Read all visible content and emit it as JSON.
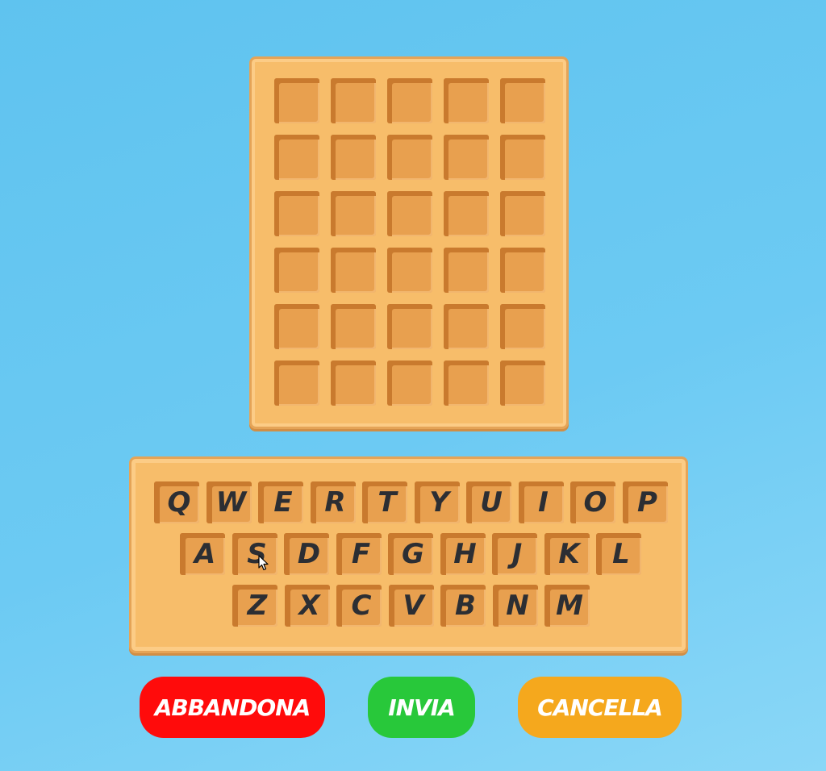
{
  "board": {
    "rows": 6,
    "cols": 5,
    "cells": [
      [
        "",
        "",
        "",
        "",
        ""
      ],
      [
        "",
        "",
        "",
        "",
        ""
      ],
      [
        "",
        "",
        "",
        "",
        ""
      ],
      [
        "",
        "",
        "",
        "",
        ""
      ],
      [
        "",
        "",
        "",
        "",
        ""
      ],
      [
        "",
        "",
        "",
        "",
        ""
      ]
    ]
  },
  "keyboard": {
    "rows": [
      [
        "Q",
        "W",
        "E",
        "R",
        "T",
        "Y",
        "U",
        "I",
        "O",
        "P"
      ],
      [
        "A",
        "S",
        "D",
        "F",
        "G",
        "H",
        "J",
        "K",
        "L"
      ],
      [
        "Z",
        "X",
        "C",
        "V",
        "B",
        "N",
        "M"
      ]
    ]
  },
  "buttons": {
    "abbandona": {
      "label": "ABBANDONA",
      "color": "#ff0b0b"
    },
    "invia": {
      "label": "INVIA",
      "color": "#28c83a"
    },
    "cancella": {
      "label": "CANCELLA",
      "color": "#f5a81d"
    }
  },
  "icons": {
    "cursor": "mouse-pointer-icon"
  }
}
